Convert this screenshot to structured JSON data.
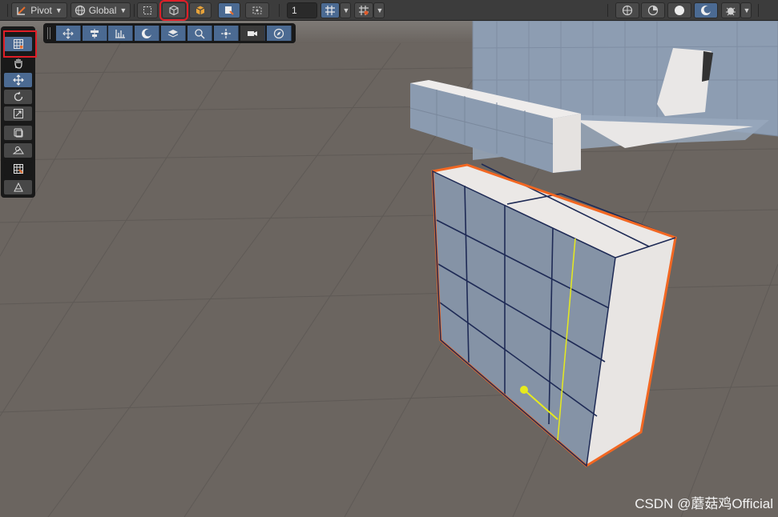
{
  "toolbar": {
    "pivot_label": "Pivot",
    "global_label": "Global",
    "grid_size_value": "1",
    "icons": [
      "pivot-mode-icon",
      "global-icon",
      "rect-tool-icon",
      "probuilder-object-mode-icon",
      "probuilder-face-icon",
      "toggle-icon",
      "view-tool-icon",
      "snap-grid-icon",
      "snap-increment-icon",
      "scene-gizmo-icon",
      "lighting-icon",
      "shading-icon",
      "render-mode-icon",
      "effects-icon"
    ]
  },
  "left_tools": {
    "icons": [
      "probuilder-grid-icon",
      "hand-tool-icon",
      "move-tool-icon",
      "rotate-tool-icon",
      "scale-tool-icon",
      "rect-tool-icon",
      "transform-icon",
      "probuilder-uv-icon",
      "custom-tool-icon"
    ],
    "active": "move-tool-icon"
  },
  "overlay_toolbar": {
    "icons": [
      "move-pivot-icon",
      "align-icon",
      "distribute-icon",
      "shading-sphere-icon",
      "layers-icon",
      "zoom-icon",
      "orbit-icon",
      "camera-icon",
      "compass-icon"
    ]
  },
  "colors": {
    "toolbar_bg": "#3c3c3c",
    "active_blue": "#4b6a92",
    "highlight_red": "#e01e27",
    "selection_orange": "#f26722",
    "ground": "#6b6560",
    "cube_face_front": "#8794a6",
    "cube_face_side": "#e8e4e2"
  },
  "watermark": "CSDN @蘑菇鸡Official"
}
